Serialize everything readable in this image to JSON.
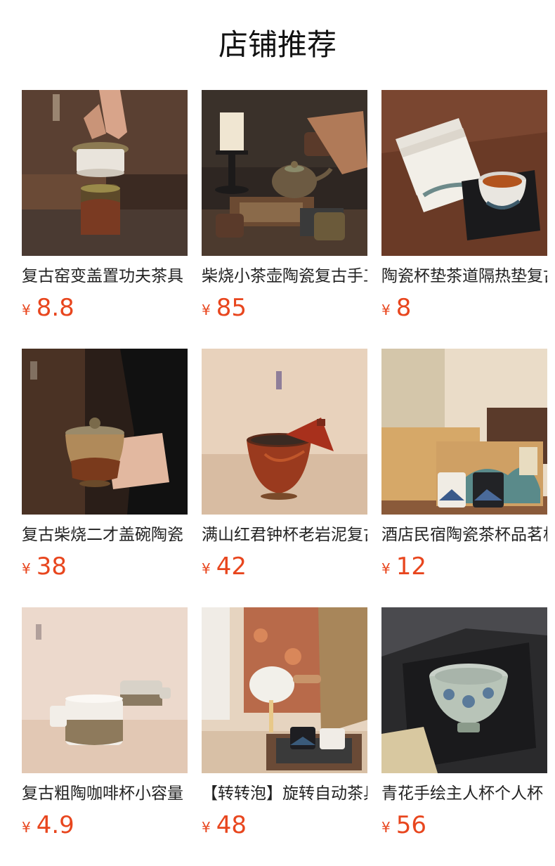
{
  "section": {
    "title": "店铺推荐"
  },
  "currency_symbol": "¥",
  "products": [
    {
      "name": "复古窑变盖置功夫茶具",
      "price": "8.8",
      "image": "ceramic-lid-rest-photo"
    },
    {
      "name": "柴烧小茶壶陶瓷复古手工",
      "price": "85",
      "image": "wood-fired-teapot-photo"
    },
    {
      "name": "陶瓷杯垫茶道隔热垫复古",
      "price": "8",
      "image": "ceramic-coaster-photo"
    },
    {
      "name": "复古柴烧二才盖碗陶瓷",
      "price": "38",
      "image": "gaiwan-bowl-photo"
    },
    {
      "name": "满山红君钟杯老岩泥复古",
      "price": "42",
      "image": "red-glaze-cup-photo"
    },
    {
      "name": "酒店民宿陶瓷茶杯品茗杯",
      "price": "12",
      "image": "gift-box-cups-photo"
    },
    {
      "name": "复古粗陶咖啡杯小容量",
      "price": "4.9",
      "image": "stoneware-coffee-cup-photo"
    },
    {
      "name": "【转转泡】旋转自动茶具",
      "price": "48",
      "image": "rotating-teapot-set-photo"
    },
    {
      "name": "青花手绘主人杯个人杯",
      "price": "56",
      "image": "blue-floral-master-cup-photo"
    }
  ]
}
